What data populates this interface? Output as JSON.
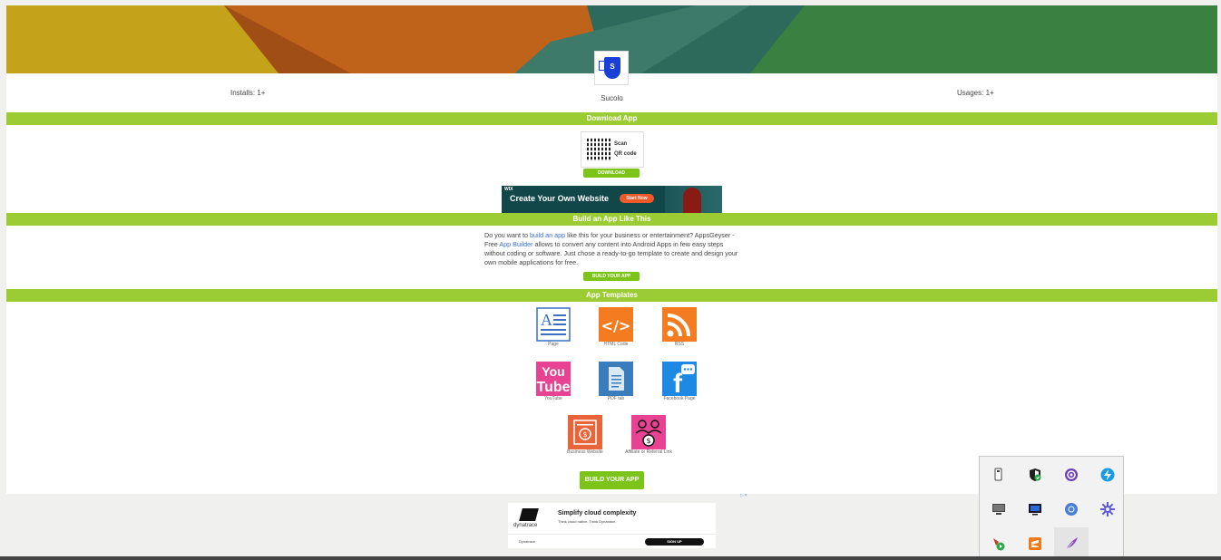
{
  "app": {
    "name": "Sucolo",
    "icon_letter": "S",
    "installs": "Installs: 1+",
    "usages": "Usages: 1+"
  },
  "sections": {
    "download": "Download App",
    "build": "Build an App Like This",
    "templates": "App Templates"
  },
  "qr": {
    "line1": "Scan",
    "line2": "QR code"
  },
  "download_button": "DOWNLOAD",
  "ad_top": {
    "brand": "WIX",
    "headline": "Create Your Own Website",
    "cta": "Start Now"
  },
  "build": {
    "t1": "Do you want to ",
    "link1": "build an app",
    "t2": " like this for your business or entertainment? AppsGeyser - Free ",
    "link2": "App Builder",
    "t3": " allows to convert any content into Android Apps in few easy steps without coding or software. Just chose a ready-to-go template to create and design your own mobile applications for free.",
    "button": "BUILD YOUR APP"
  },
  "templates": [
    {
      "label": "Page",
      "icon": "page-icon",
      "color": "#ffffff"
    },
    {
      "label": "HTML Code",
      "icon": "html-code-icon",
      "color": "#f47b20"
    },
    {
      "label": "RSS",
      "icon": "rss-icon",
      "color": "#f47b20"
    },
    {
      "label": "YouTube",
      "icon": "youtube-icon",
      "color": "#e84393"
    },
    {
      "label": "PDF tab",
      "icon": "pdf-icon",
      "color": "#3a7dbd"
    },
    {
      "label": "Facebook Page",
      "icon": "facebook-icon",
      "color": "#1e88e5"
    },
    {
      "label": "Business Website",
      "icon": "business-website-icon",
      "color": "#e8643a"
    },
    {
      "label": "Affiliate or Referral Link",
      "icon": "affiliate-link-icon",
      "color": "#e84393"
    }
  ],
  "build_button_main": "BUILD YOUR APP",
  "ad_bottom": {
    "logo": "dynatrace",
    "headline": "Simplify cloud complexity",
    "sub": "Think cloud native. Think Dynatrace.",
    "name": "Dynatrace",
    "cta": "SIGN UP"
  },
  "tray_icons": [
    "usb-drive-icon",
    "security-shield-icon",
    "browser-app-icon",
    "lightning-app-icon",
    "display-icon",
    "monitor-app-icon",
    "chrome-icon",
    "settings-gear-icon",
    "media-player-icon",
    "sublime-text-icon",
    "feather-pen-icon"
  ],
  "colors": {
    "accent": "#9ccc34",
    "button": "#7cc41a"
  }
}
